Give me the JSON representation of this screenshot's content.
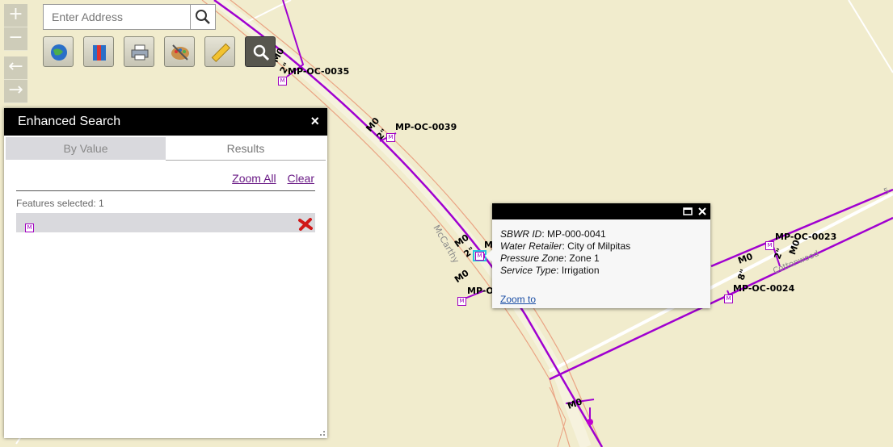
{
  "search": {
    "placeholder": "Enter Address"
  },
  "map": {
    "meter_labels": [
      "MP-OC-0035",
      "MP-OC-0039",
      "MP-OC-0023",
      "MP-OC-0024",
      "M",
      "MP-O"
    ],
    "pipe_labels": [
      "M0",
      "2\"",
      "M0",
      "2\"",
      "M0",
      "2\"",
      "M0",
      "M0",
      "8\"",
      "M0",
      "2\"",
      "M0"
    ],
    "street_labels": [
      "McCarthy",
      "Cottonwood",
      "5"
    ],
    "meter_marker": "M"
  },
  "panel": {
    "title": "Enhanced Search",
    "close": "×",
    "tabs": [
      "By Value",
      "Results"
    ],
    "zoom_all": "Zoom All",
    "clear": "Clear",
    "count": "Features selected: 1",
    "result_marker": "M"
  },
  "popup": {
    "fields": [
      {
        "label": "SBWR ID",
        "value": "MP-000-0041"
      },
      {
        "label": "Water Retailer",
        "value": "City of Milpitas"
      },
      {
        "label": "Pressure Zone",
        "value": "Zone 1"
      },
      {
        "label": "Service Type",
        "value": "Irrigation"
      }
    ],
    "zoom_to": "Zoom to"
  },
  "colors": {
    "map_bg": "#f1eccd",
    "pipe": "#a000d0",
    "road_edge": "#e8a07a"
  }
}
